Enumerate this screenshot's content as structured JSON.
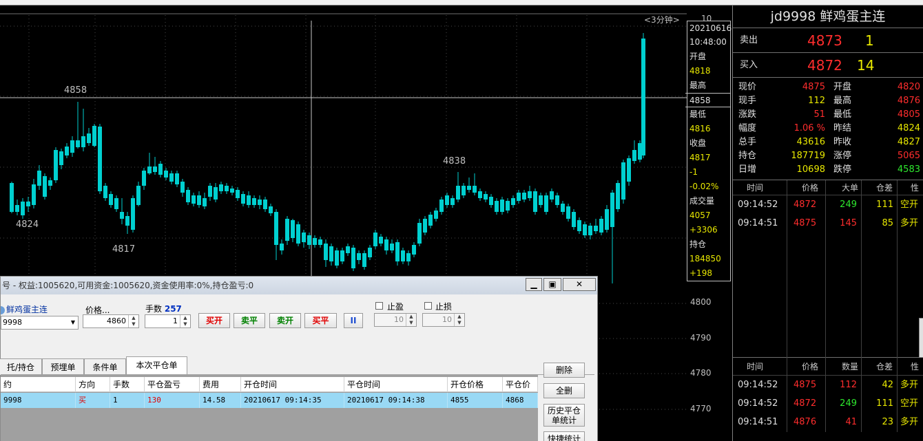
{
  "chart": {
    "interval": "<3分钟>",
    "interval_num": "10",
    "high_label": "4858",
    "low_label": "4824",
    "low2_label": "4817",
    "mid_label": "4838",
    "axis": [
      "4800",
      "4790",
      "4780",
      "4770"
    ],
    "colors": {
      "up": "#ff2020",
      "down": "#00d0d0",
      "grid": "#4a4a4a",
      "crosshair": "#c8c8c8"
    }
  },
  "info": {
    "date": "20210616",
    "time": "10:48:00",
    "open_label": "开盘",
    "open_val": "4818",
    "high_label": "最高",
    "high_val": "4858",
    "low_label": "最低",
    "low_val": "4816",
    "close_label": "收盘",
    "close_val": "4817",
    "change": "-1",
    "change_pct": "-0.02%",
    "vol_label": "成交量",
    "vol_val": "4057",
    "vol_chg": "+3306",
    "oi_label": "持仓",
    "oi_val": "184850",
    "oi_chg": "+198"
  },
  "right": {
    "title": "jd9998  鲜鸡蛋主连",
    "ask": {
      "label": "卖出",
      "price": "4873",
      "qty": "1"
    },
    "bid": {
      "label": "买入",
      "price": "4872",
      "qty": "14"
    },
    "quotes": [
      {
        "l1": "现价",
        "v1": "4875",
        "c1": "red",
        "l2": "开盘",
        "v2": "4820",
        "c2": "red"
      },
      {
        "l1": "现手",
        "v1": "112",
        "c1": "yellow",
        "l2": "最高",
        "v2": "4876",
        "c2": "red"
      },
      {
        "l1": "涨跌",
        "v1": "51",
        "c1": "red",
        "l2": "最低",
        "v2": "4805",
        "c2": "red"
      },
      {
        "l1": "幅度",
        "v1": "1.06 %",
        "c1": "red",
        "l2": "昨结",
        "v2": "4824",
        "c2": "yellow"
      },
      {
        "l1": "总手",
        "v1": "43616",
        "c1": "yellow",
        "l2": "昨收",
        "v2": "4827",
        "c2": "yellow"
      },
      {
        "l1": "持仓",
        "v1": "187719",
        "c1": "yellow",
        "l2": "涨停",
        "v2": "5065",
        "c2": "red"
      },
      {
        "l1": "日增",
        "v1": "10698",
        "c1": "yellow",
        "l2": "跌停",
        "v2": "4583",
        "c2": "green"
      }
    ],
    "trades1_headers": [
      "时间",
      "价格",
      "大单",
      "仓差",
      "性"
    ],
    "trades1": [
      {
        "time": "09:14:52",
        "price": "4872",
        "size": "249",
        "size_c": "green",
        "oi": "111",
        "kind": "空开"
      },
      {
        "time": "09:14:51",
        "price": "4875",
        "size": "145",
        "size_c": "red",
        "oi": "85",
        "kind": "多开"
      }
    ],
    "trades2_headers": [
      "时间",
      "价格",
      "数量",
      "仓差",
      "性"
    ],
    "trades2": [
      {
        "time": "09:14:52",
        "price": "4875",
        "size": "112",
        "size_c": "red",
        "oi": "42",
        "kind": "多开"
      },
      {
        "time": "09:14:52",
        "price": "4872",
        "size": "249",
        "size_c": "green",
        "oi": "111",
        "kind": "空开"
      },
      {
        "time": "09:14:51",
        "price": "4876",
        "size": "41",
        "size_c": "red",
        "oi": "23",
        "kind": "多开"
      }
    ]
  },
  "dialog": {
    "title": "号 - 权益:1005620,可用资金:1005620,资金使用率:0%,持仓盈亏:0",
    "contract_name": "鲜鸡蛋主连",
    "contract_code": "9998",
    "price_label": "价格...",
    "price_val": "4860",
    "qty_label": "手数",
    "qty_max": "257",
    "qty_val": "1",
    "btn_buy_open": "买开",
    "btn_sell_close": "卖平",
    "btn_sell_open": "卖开",
    "btn_buy_close": "买平",
    "btn_pause": "II",
    "tp_label": "止盈",
    "tp_val": "10",
    "sl_label": "止损",
    "sl_val": "10",
    "tabs": [
      "托/持仓",
      "预埋单",
      "条件单",
      "本次平仓单"
    ],
    "grid_headers": [
      "约",
      "方向",
      "手数",
      "平仓盈亏",
      "费用",
      "开仓时间",
      "平仓时间",
      "开仓价格",
      "平仓价格"
    ],
    "grid_row": [
      "9998",
      "买",
      "1",
      "130",
      "14.58",
      "20210617 09:14:35",
      "20210617 09:14:38",
      "4855",
      "4868"
    ],
    "side_delete": "删除",
    "side_delete_all": "全删",
    "side_history": "历史平仓单统计",
    "side_quick": "快捷统计"
  }
}
